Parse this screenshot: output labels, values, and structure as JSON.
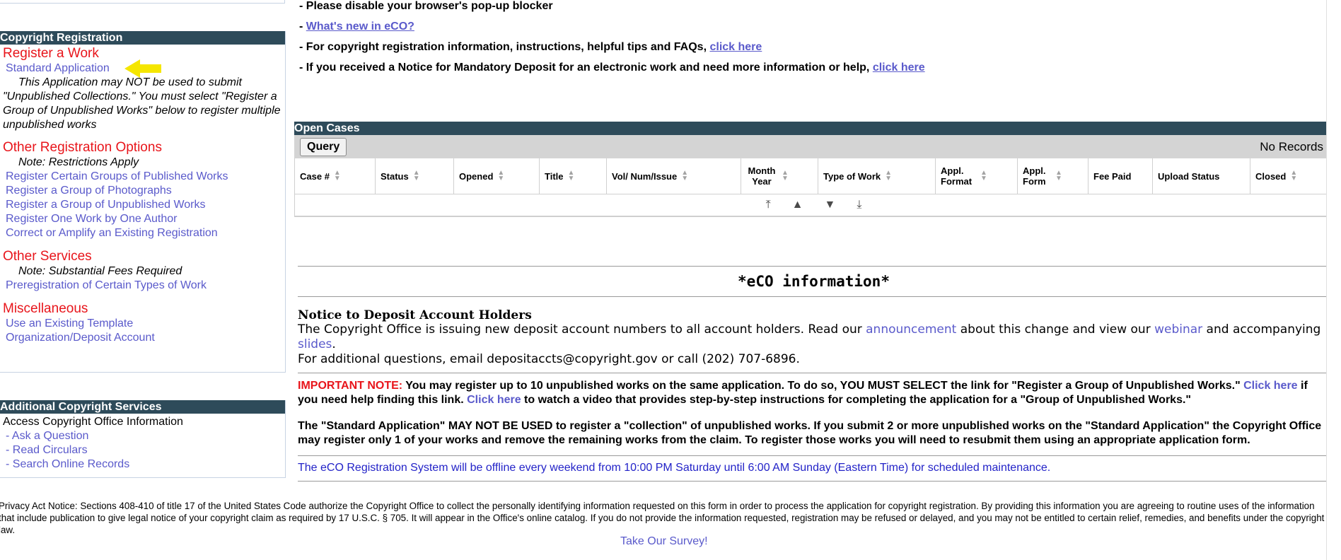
{
  "sidebar": {
    "reg_panel_title": "Copyright Registration",
    "register_work": {
      "title": "Register a Work",
      "standard_app": "Standard Application",
      "desc": "This Application may NOT be used to submit \"Unpublished Collections.\" You must select \"Register a Group of Unpublished Works\" below to register multiple unpublished works"
    },
    "other_options": {
      "title": "Other Registration Options",
      "note": "Note: Restrictions Apply",
      "links": [
        "Register Certain Groups of Published Works",
        "Register a Group of Photographs",
        "Register a Group of Unpublished Works",
        "Register One Work by One Author",
        "Correct or Amplify an Existing Registration"
      ]
    },
    "other_services": {
      "title": "Other Services",
      "note": "Note: Substantial Fees Required",
      "link": "Preregistration of Certain Types of Work"
    },
    "misc": {
      "title": "Miscellaneous",
      "links": [
        "Use an Existing Template",
        "Organization/Deposit Account"
      ]
    },
    "additional_panel_title": "Additional Copyright Services",
    "access_label": "Access Copyright Office Information",
    "access_links": [
      "- Ask a Question",
      "- Read Circulars",
      "- Search Online Records"
    ]
  },
  "bullets": {
    "popup": "- Please disable your browser's pop-up blocker",
    "whats_new_prefix": "- ",
    "whats_new_link": "What's new in eCO?",
    "registration_info": "- For copyright registration information, instructions, helpful tips and FAQs, ",
    "registration_link": "click here",
    "mandatory_deposit": "- If you received a Notice for Mandatory Deposit for an electronic work and need more information or help, ",
    "mandatory_link": "click here"
  },
  "open_cases": {
    "title": "Open Cases",
    "query_button": "Query",
    "no_records": "No Records",
    "columns": [
      "Case #",
      "Status",
      "Opened",
      "Title",
      "Vol/ Num/Issue",
      "Month Year",
      "Type of Work",
      "Appl. Format",
      "Appl. Form",
      "Fee Paid",
      "Upload Status",
      "Closed"
    ]
  },
  "eco_info": {
    "title": "*eCO information*",
    "notice_heading": "Notice to Deposit Account Holders",
    "notice_p1": "The Copyright Office is issuing new deposit account numbers to all account holders. Read our ",
    "announcement": "announcement",
    "notice_p2": " about this change and view our ",
    "webinar": "webinar",
    "notice_p3": " and accompanying ",
    "slides": "slides",
    "notice_p4": ".",
    "notice_line2": "For additional questions, email depositaccts@copyright.gov or call (202) 707-6896.",
    "important_label": "IMPORTANT NOTE:",
    "important_p1": " You may register up to 10 unpublished works on the same application. To do so, YOU MUST SELECT the link for \"Register a Group of Unpublished Works.\" ",
    "important_link1": "Click here",
    "important_p2": " if you need help finding this link. ",
    "important_link2": "Click here",
    "important_p3": " to watch a video that provides step-by-step instructions for completing the application for a \"Group of Unpublished Works.\"",
    "standard_warning": "The \"Standard Application\" MAY NOT BE USED to register a \"collection\" of unpublished works. If you submit 2 or more unpublished works on the \"Standard Application\" the Copyright Office may register only 1 of your works and remove the remaining works from the claim. To register those works you will need to resubmit them using an appropriate application form.",
    "offline": "The eCO Registration System will be offline every weekend from 10:00 PM Saturday until 6:00 AM Sunday (Eastern Time) for scheduled maintenance."
  },
  "privacy": "Privacy Act Notice: Sections 408-410 of title 17 of the United States Code authorize the Copyright Office to collect the personally identifying information requested on this form in order to process the application for copyright registration. By providing this information you are agreeing to routine uses of the information that include publication to give legal notice of your copyright claim as required by 17 U.S.C. § 705. It will appear in the Office's online catalog. If you do not provide the information requested, registration may be refused or delayed, and you may not be entitled to certain relief, remedies, and benefits under the copyright law.",
  "survey": "Take Our Survey!",
  "colors": {
    "header_bg": "#2e4b5a",
    "link": "#5a5acb",
    "section_red": "#e8151b",
    "arrow": "#f5e600"
  }
}
